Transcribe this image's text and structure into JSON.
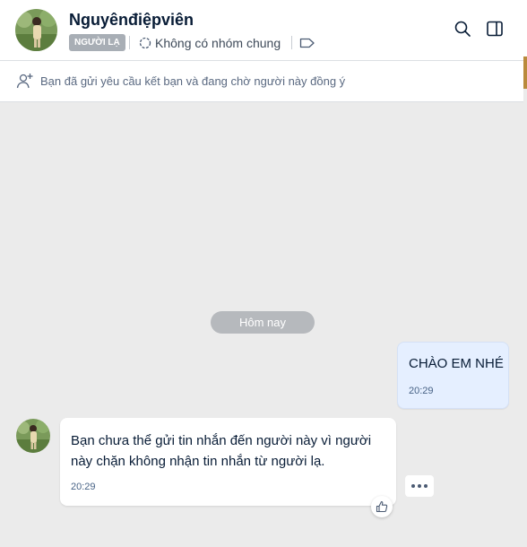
{
  "header": {
    "name": "Nguyênđiệpviên",
    "badge": "NGƯỜI LẠ",
    "group_info": "Không có nhóm chung",
    "icons": {
      "group": "circle-dashed-icon",
      "tag": "tag-icon",
      "search": "search-icon",
      "panel": "side-panel-icon"
    }
  },
  "notice": {
    "text": "Bạn đã gửi yêu cầu kết bạn và đang chờ người này đồng ý",
    "icon": "add-friend-icon"
  },
  "conversation": {
    "date_divider": "Hôm nay",
    "messages": [
      {
        "direction": "outgoing",
        "text": "CHÀO EM NHÉ",
        "time": "20:29"
      },
      {
        "direction": "incoming",
        "text": "Bạn chưa thể gửi tin nhắn đến người này vì người này chặn không nhận tin nhắn từ người lạ.",
        "time": "20:29"
      }
    ],
    "actions": {
      "like": "thumbs-up-icon",
      "more": "more-options-icon"
    }
  },
  "colors": {
    "outgoing_bubble": "#e5efff",
    "incoming_bubble": "#ffffff",
    "chat_background": "#ebebeb",
    "badge_background": "#a8aeb5"
  }
}
